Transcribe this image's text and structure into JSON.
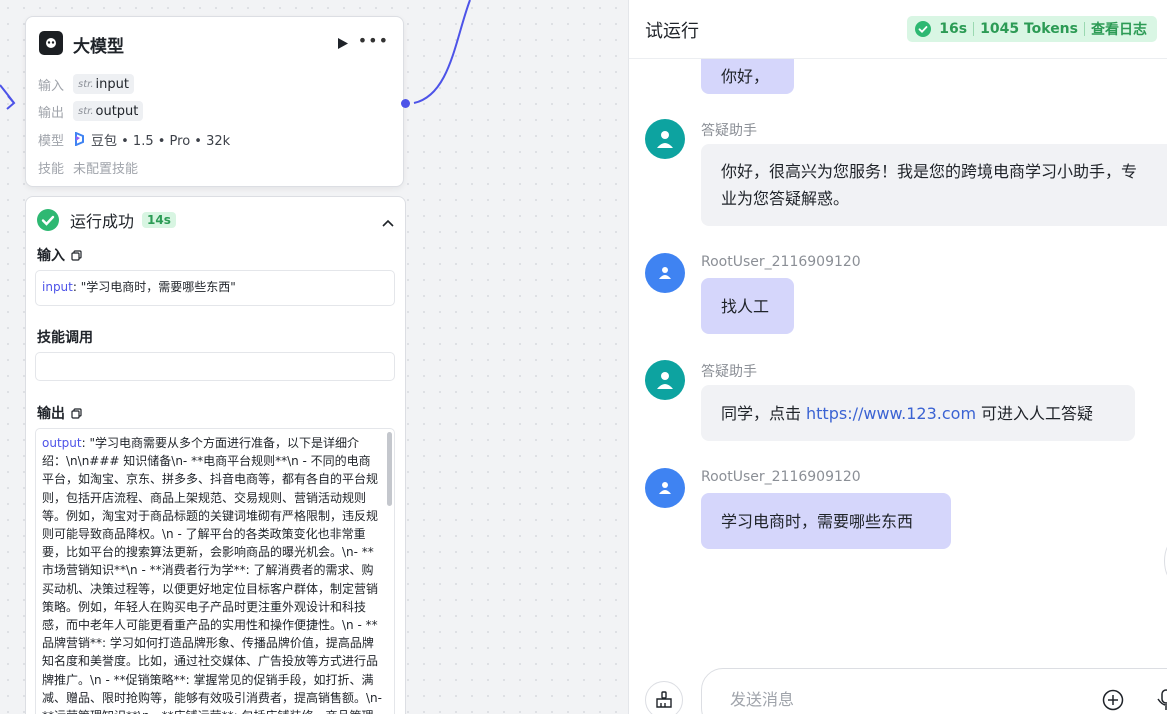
{
  "node": {
    "title": "大模型",
    "input_label": "输入",
    "input_type": "str.",
    "input_name": "input",
    "output_label": "输出",
    "output_type": "str.",
    "output_name": "output",
    "model_label": "模型",
    "model_value": "豆包 • 1.5 • Pro • 32k",
    "skill_label": "技能",
    "skill_value": "未配置技能"
  },
  "result": {
    "status": "运行成功",
    "time": "14s",
    "input_section": "输入",
    "input_key": "input",
    "input_value": ": \"学习电商时，需要哪些东西\"",
    "skill_section": "技能调用",
    "output_section": "输出",
    "output_key": "output",
    "output_value": ": \"学习电商需要从多个方面进行准备，以下是详细介绍：\\n\\n### 知识储备\\n- **电商平台规则**\\n - 不同的电商平台，如淘宝、京东、拼多多、抖音电商等，都有各自的平台规则，包括开店流程、商品上架规范、交易规则、营销活动规则等。例如，淘宝对于商品标题的关键词堆砌有严格限制，违反规则可能导致商品降权。\\n - 了解平台的各类政策变化也非常重要，比如平台的搜索算法更新，会影响商品的曝光机会。\\n- **市场营销知识**\\n - **消费者行为学**: 了解消费者的需求、购买动机、决策过程等，以便更好地定位目标客户群体，制定营销策略。例如，年轻人在购买电子产品时更注重外观设计和科技感，而中老年人可能更看重产品的实用性和操作便捷性。\\n - **品牌营销**: 学习如何打造品牌形象、传播品牌价值，提高品牌知名度和美誉度。比如，通过社交媒体、广告投放等方式进行品牌推广。\\n - **促销策略**: 掌握常见的促销手段，如打折、满减、赠品、限时抢购等，能够有效吸引消费者，提高销售额。\\n- **运营管理知识**\\n - **店铺运营**: 包括店铺装修、商品管理"
  },
  "panel": {
    "title": "试运行",
    "time": "16s",
    "tokens": "1045 Tokens",
    "log_link": "查看日志",
    "messages": [
      {
        "name": "",
        "text": "你好，"
      },
      {
        "name": "答疑助手",
        "text1": "你好，很高兴为您服务！我是您的跨境电商学习小助手，专",
        "text2": "业为您答疑解惑。"
      },
      {
        "name": "RootUser_2116909120",
        "text": "找人工"
      },
      {
        "name": "答疑助手",
        "pre": "同学，点击",
        "link": "https://www.123.com",
        "post": "可进入人工答疑"
      },
      {
        "name": "RootUser_2116909120",
        "text": "学习电商时，需要哪些东西"
      }
    ],
    "input_placeholder": "发送消息"
  },
  "colors": {
    "accent": "#4d53e8",
    "success": "#2c9b55",
    "bot_avatar": "#0da3a0",
    "user_avatar": "#3f83f2",
    "user_bubble": "#d5d6fb"
  }
}
